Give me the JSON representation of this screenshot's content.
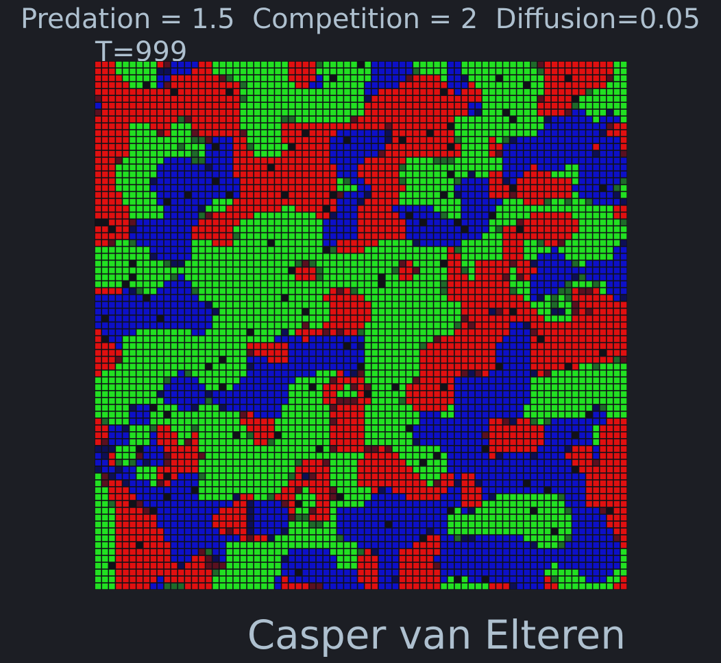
{
  "figure": {
    "title": "Predation = 1.5  Competition = 2  Diffusion=0.05",
    "time_label": "T=999",
    "author": "Casper van Elteren"
  },
  "lattice": {
    "rows": 77,
    "cols": 77,
    "species_colors": {
      "species_a": "#e01010",
      "species_b": "#22e022",
      "species_c": "#0d10c8",
      "mixed_dark_green": "#1f6a2a",
      "mixed_dark_red": "#5a1020",
      "mixed_dark_blue": "#0d0f55",
      "empty": "#111118"
    },
    "background_color": "#1c1e24"
  }
}
